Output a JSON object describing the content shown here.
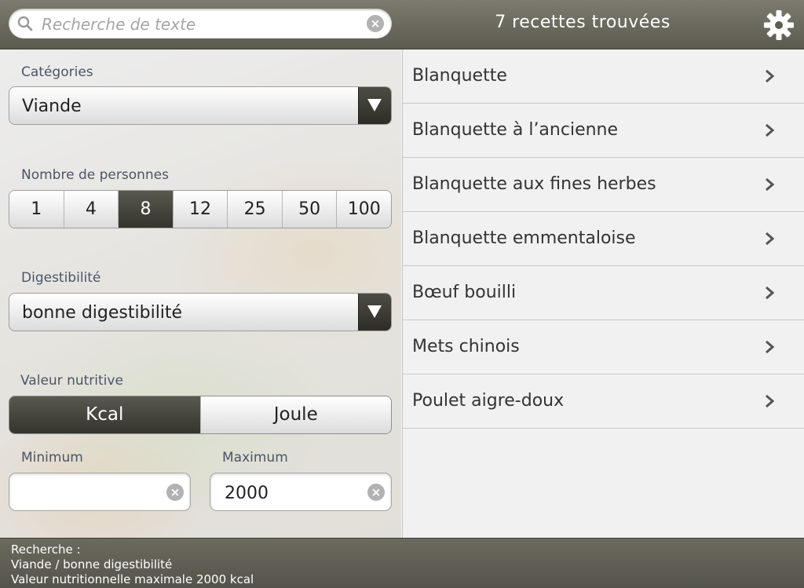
{
  "search": {
    "placeholder": "Recherche de texte",
    "icon": "search-icon"
  },
  "header": {
    "results_title": "7 recettes trouvées"
  },
  "filters": {
    "category_label": "Catégories",
    "category_value": "Viande",
    "persons_label": "Nombre de personnes",
    "persons_options": [
      "1",
      "4",
      "8",
      "12",
      "25",
      "50",
      "100"
    ],
    "persons_selected": "8",
    "digest_label": "Digestibilité",
    "digest_value": "bonne digestibilité",
    "nutrition_label": "Valeur nutritive",
    "units": [
      "Kcal",
      "Joule"
    ],
    "unit_selected": "Kcal",
    "min_label": "Minimum",
    "min_value": "",
    "max_label": "Maximum",
    "max_value": "2000"
  },
  "recipes": [
    "Blanquette",
    "Blanquette à l’ancienne",
    "Blanquette aux fines herbes",
    "Blanquette emmentaloise",
    "Bœuf bouilli",
    "Mets chinois",
    "Poulet aigre-doux"
  ],
  "footer": {
    "line1": "Recherche :",
    "line2": "Viande / bonne digestibilité",
    "line3": "Valeur nutritionnelle maximale 2000 kcal"
  },
  "colors": {
    "bar": "#5c5b50",
    "active_segment": "#3f3e36",
    "list_bg": "#f1f1f1"
  }
}
